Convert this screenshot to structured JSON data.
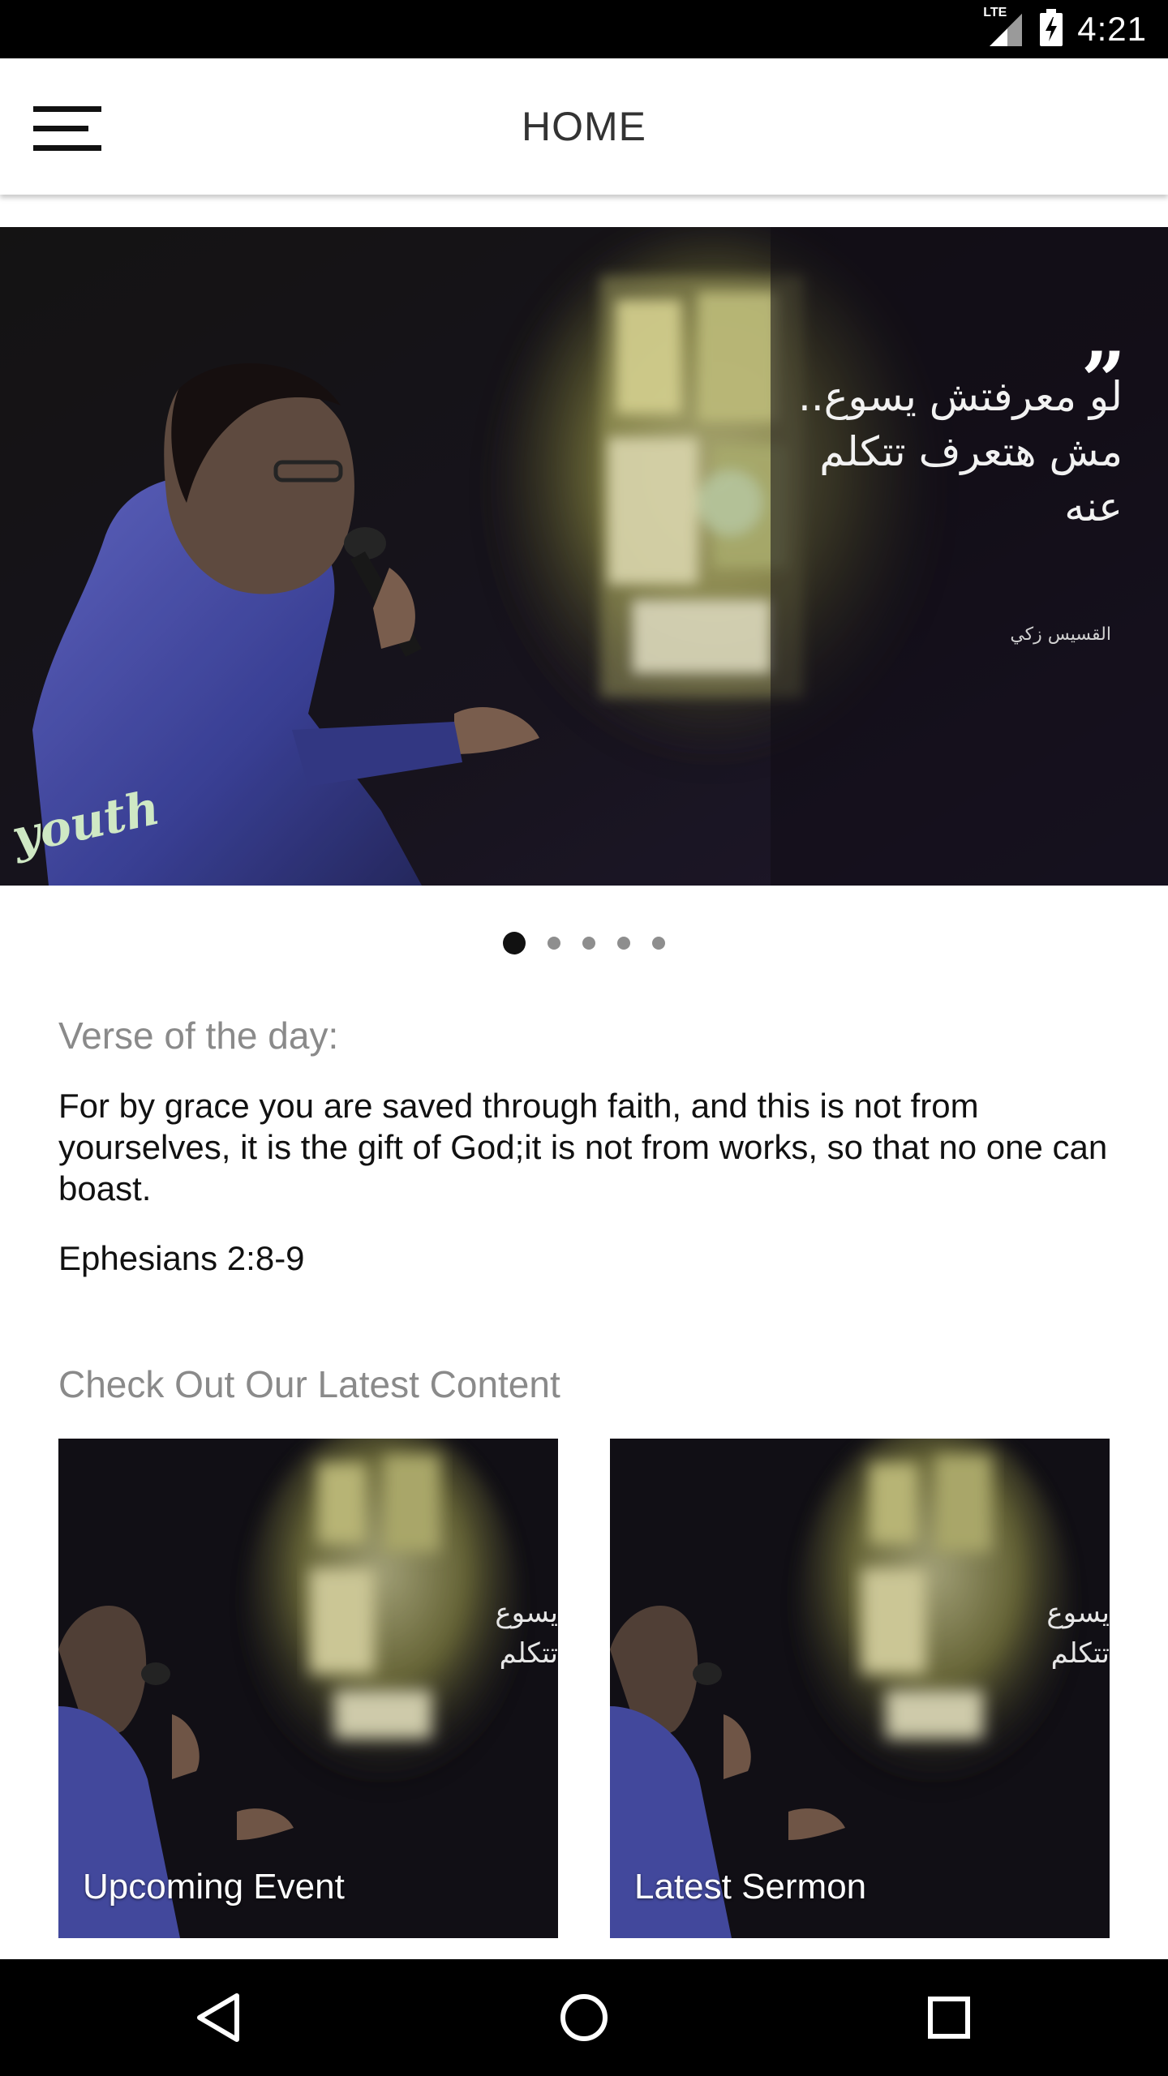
{
  "status_bar": {
    "time": "4:21",
    "network": "LTE",
    "icons": [
      "signal-icon",
      "battery-charging-icon"
    ]
  },
  "app_bar": {
    "title": "HOME",
    "menu_icon": "hamburger-menu-icon"
  },
  "hero": {
    "quote_mark": "”",
    "quote_lines": [
      "لو معرفتش يسوع..",
      "مش هتعرف تتكلم",
      "عنه"
    ],
    "author": "القسيس زكي",
    "logo_text": "youth",
    "slide_count": 5,
    "active_slide": 1
  },
  "verse": {
    "label": "Verse of the day:",
    "text": "For by grace you are saved through faith, and this is not from yourselves, it is the gift of God;it is not from works, so that no one can boast.",
    "reference": "Ephesians 2:8-9"
  },
  "latest": {
    "label": "Check Out Our Latest Content",
    "cards": [
      {
        "label": "Upcoming Event",
        "arabic_lines": [
          "يسوع",
          "تتكلم"
        ]
      },
      {
        "label": "Latest Sermon",
        "arabic_lines": [
          "يسوع",
          "تتكلم"
        ]
      }
    ]
  },
  "nav_bar": {
    "buttons": [
      "back-icon",
      "home-icon",
      "recents-icon"
    ]
  },
  "colors": {
    "status_bar": "#000000",
    "app_bar": "#ffffff",
    "label_gray": "#8a8a8a",
    "text": "#111111",
    "photo_dark": "#15111c"
  }
}
